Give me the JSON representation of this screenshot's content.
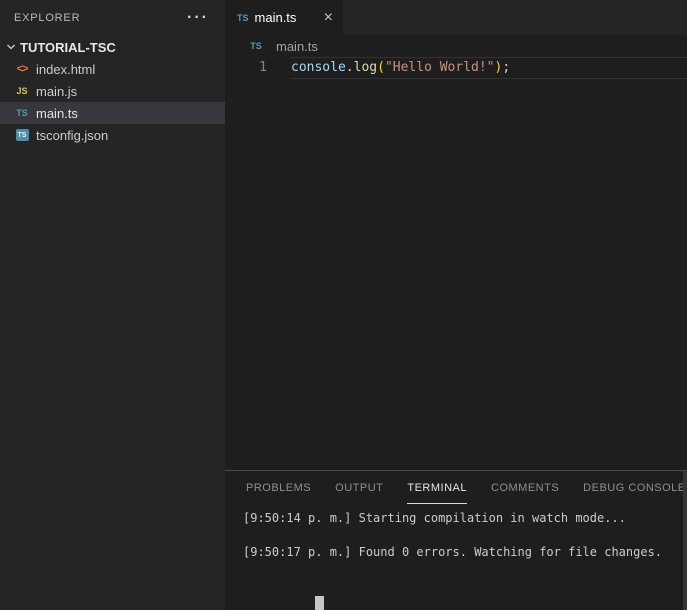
{
  "colors": {
    "sidebar_bg": "#252526",
    "editor_bg": "#1e1e1e",
    "selected_row_bg": "#37373d",
    "panel_border": "#4b4b4b",
    "ts_icon_blue": "#519aba",
    "js_icon_yellow": "#d4c952",
    "html_icon_orange": "#e37933",
    "line_highlight_border": "#323233",
    "terminal_text": "#cccccc"
  },
  "sidebar": {
    "title": "EXPLORER",
    "menu_icon": "···",
    "folder": "TUTORIAL-TSC",
    "files": [
      {
        "name": "index.html",
        "icon_glyph": "<>",
        "selected": false
      },
      {
        "name": "main.js",
        "icon_glyph": "JS",
        "selected": false
      },
      {
        "name": "main.ts",
        "icon_glyph": "TS",
        "selected": true
      },
      {
        "name": "tsconfig.json",
        "icon_glyph": "TS",
        "selected": false
      }
    ]
  },
  "editor": {
    "tab": {
      "icon_glyph": "TS",
      "label": "main.ts",
      "close_glyph": "×"
    },
    "breadcrumb": {
      "icon_glyph": "TS",
      "label": "main.ts"
    },
    "code": {
      "line_number": "1",
      "raw_line": "console.log(\"Hello World!\");",
      "tokens": [
        {
          "text": "console",
          "color": "#9cdcfe"
        },
        {
          "text": ".",
          "color": "#d4d4d4"
        },
        {
          "text": "log",
          "color": "#dcdcaa"
        },
        {
          "text": "(",
          "color": "#ffd700"
        },
        {
          "text": "\"Hello World!\"",
          "color": "#ce9178"
        },
        {
          "text": ")",
          "color": "#ffd700"
        },
        {
          "text": ";",
          "color": "#d4d4d4"
        }
      ]
    }
  },
  "panel": {
    "tabs": [
      {
        "label": "PROBLEMS",
        "active": false
      },
      {
        "label": "OUTPUT",
        "active": false
      },
      {
        "label": "TERMINAL",
        "active": true
      },
      {
        "label": "COMMENTS",
        "active": false
      },
      {
        "label": "DEBUG CONSOLE",
        "active": false
      }
    ],
    "terminal_lines": [
      "[9:50:14 p. m.] Starting compilation in watch mode...",
      "",
      "[9:50:17 p. m.] Found 0 errors. Watching for file changes.",
      ""
    ]
  }
}
